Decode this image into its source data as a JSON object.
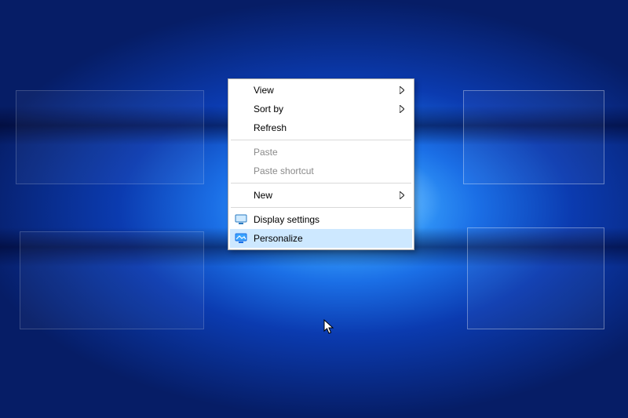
{
  "context_menu": {
    "items": {
      "view": {
        "label": "View"
      },
      "sort_by": {
        "label": "Sort by"
      },
      "refresh": {
        "label": "Refresh"
      },
      "paste": {
        "label": "Paste"
      },
      "paste_shortcut": {
        "label": "Paste shortcut"
      },
      "new": {
        "label": "New"
      },
      "display_settings": {
        "label": "Display settings"
      },
      "personalize": {
        "label": "Personalize"
      }
    }
  }
}
